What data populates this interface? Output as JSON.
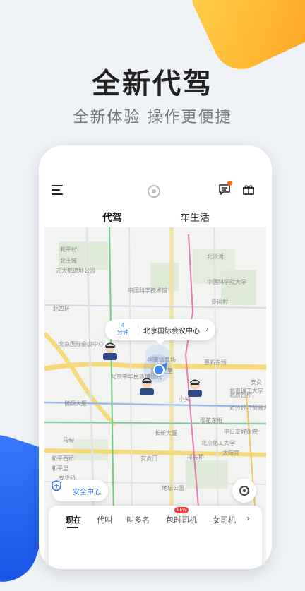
{
  "promo": {
    "headline": "全新代驾",
    "subline": "全新体验 操作更便捷"
  },
  "app": {
    "tabs": [
      {
        "label": "代驾",
        "active": true
      },
      {
        "label": "车生活",
        "active": false
      }
    ],
    "icons": {
      "menu": "menu-icon",
      "logo": "logo-icon",
      "message": "message-icon",
      "gift": "gift-icon"
    },
    "message_badge_color": "#ff6a1a"
  },
  "map": {
    "callout": {
      "eta_number": "4",
      "eta_unit": "分钟",
      "place": "北京国际会议中心",
      "arrow": "›"
    },
    "labels": [
      "和平村",
      "北土城",
      "元大都遗址公园",
      "北沙滩",
      "中国科学技术馆",
      "中国科学院大学",
      "亚运村",
      "惠新东桥",
      "北四环",
      "北京国际会议中心",
      "国家体育场",
      "北京中华民族博物院",
      "慧忠北里",
      "安贞",
      "小关",
      "北辰西桥",
      "健翔大厦",
      "马甸",
      "长新大厦",
      "樱花东街",
      "中日友好医院",
      "北京化工大学",
      "和平西桥",
      "和平里",
      "安贞门",
      "太阳宫",
      "祁先桥",
      "安华桥",
      "北京理工大学",
      "对外经济贸易大学",
      "地坛公园"
    ],
    "safety_button": "安全中心",
    "route_color": "#3b86f7"
  },
  "bottom_tabs": [
    {
      "label": "现在",
      "active": true
    },
    {
      "label": "代叫",
      "active": false
    },
    {
      "label": "叫多名",
      "active": false
    },
    {
      "label": "包时司机",
      "active": false,
      "badge": "NEW"
    },
    {
      "label": "女司机",
      "active": false
    }
  ],
  "bottom_more": "›",
  "colors": {
    "accent_blue": "#3b86f7",
    "accent_orange": "#ffa11f",
    "badge_red": "#ff3b3b"
  }
}
